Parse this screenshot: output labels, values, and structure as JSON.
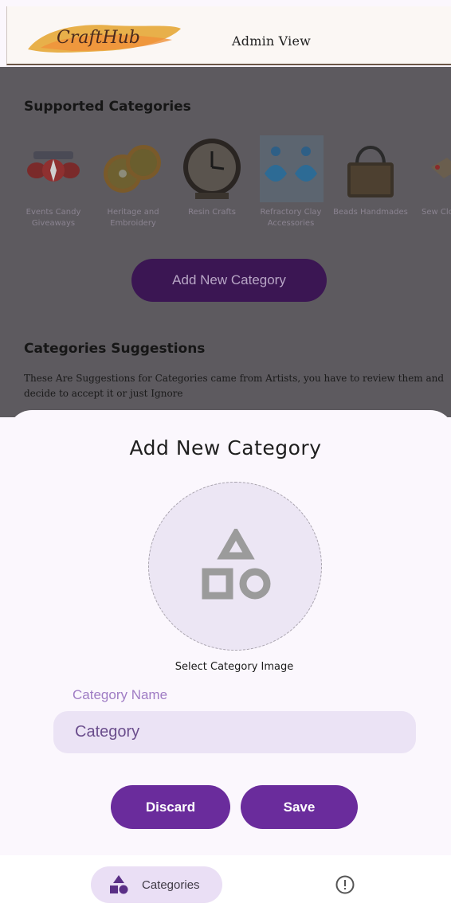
{
  "header": {
    "logo_text": "CraftHub",
    "title": "Admin View"
  },
  "supported": {
    "title": "Supported Categories",
    "items": [
      {
        "label": "Events Candy Giveaways"
      },
      {
        "label": "Heritage and Embroidery"
      },
      {
        "label": "Resin Crafts"
      },
      {
        "label": "Refractory Clay Accessories"
      },
      {
        "label": "Beads Handmades"
      },
      {
        "label": "Sew Clot"
      }
    ],
    "add_button": "Add New Category"
  },
  "suggestions": {
    "title": "Categories Suggestions",
    "text": "These Are Suggestions for Categories came from Artists, you have to review them and decide to accept it or just Ignore"
  },
  "sheet": {
    "title": "Add New Category",
    "select_image_label": "Select Category Image",
    "field_label": "Category Name",
    "field_placeholder": "Category",
    "discard_label": "Discard",
    "save_label": "Save"
  },
  "nav": {
    "categories_label": "Categories",
    "categories_icon": "shapes-icon",
    "alert_icon": "alert-circle-icon"
  },
  "colors": {
    "primary": "#6a2c9c",
    "field_bg": "#ebe3f5",
    "label": "#9f7cc4"
  }
}
